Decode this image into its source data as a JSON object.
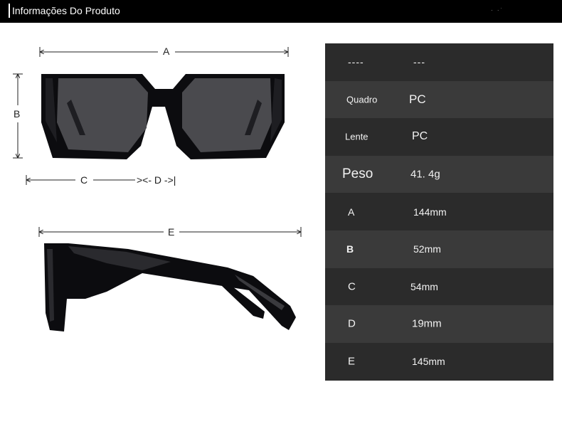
{
  "header": {
    "title": "Informações Do Produto"
  },
  "dimension_labels": {
    "a": "A",
    "b": "B",
    "c": "C",
    "d": "><- D ->|",
    "e": "E"
  },
  "specs": {
    "rows": [
      {
        "key": "----",
        "value": "---"
      },
      {
        "key": "Quadro",
        "value": "PC"
      },
      {
        "key": "Lente",
        "value": "PC"
      },
      {
        "key": "Peso",
        "value": "41. 4g"
      },
      {
        "key": "A",
        "value": "144mm"
      },
      {
        "key": "B",
        "value": "52mm"
      },
      {
        "key": "C",
        "value": "54mm"
      },
      {
        "key": "D",
        "value": "19mm"
      },
      {
        "key": "E",
        "value": "145mm"
      }
    ]
  },
  "colors": {
    "topbar": "#000000",
    "table_dark": "#2b2b2b",
    "table_light": "#3a3a3a",
    "frame": "#0c0c0f",
    "lens": "#4a4a4e"
  }
}
